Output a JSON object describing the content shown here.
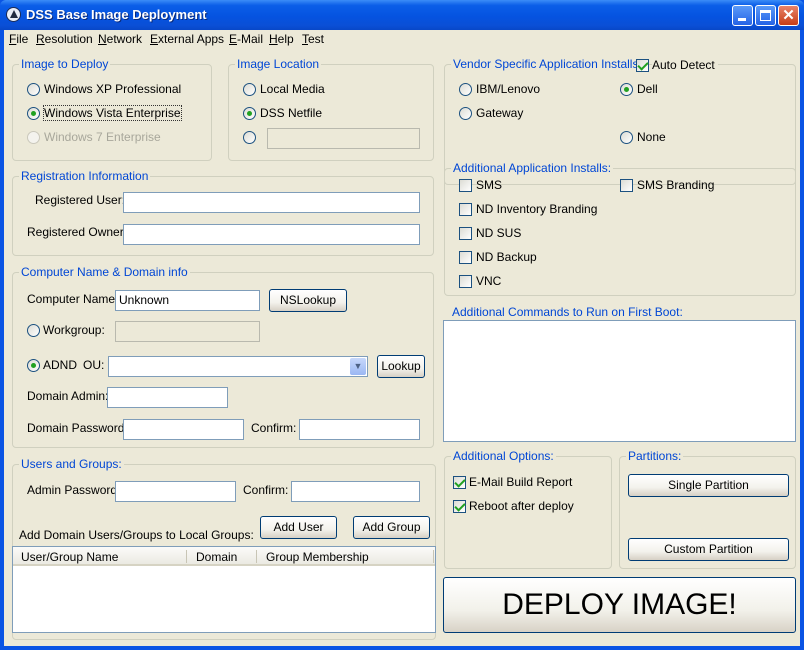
{
  "window": {
    "title": "DSS Base Image Deployment"
  },
  "menu": [
    "File",
    "Resolution",
    "Network",
    "External Apps",
    "E-Mail",
    "Help",
    "Test"
  ],
  "image_to_deploy": {
    "title": "Image to Deploy",
    "options": [
      {
        "label": "Windows XP Professional",
        "selected": false,
        "enabled": true
      },
      {
        "label": "Windows Vista Enterprise",
        "selected": true,
        "enabled": true
      },
      {
        "label": "Windows 7 Enterprise",
        "selected": false,
        "enabled": false
      }
    ]
  },
  "image_location": {
    "title": "Image Location",
    "options": [
      {
        "label": "Local Media",
        "selected": false
      },
      {
        "label": "DSS Netfile",
        "selected": true
      },
      {
        "label": "",
        "selected": false
      }
    ],
    "custom_path": ""
  },
  "registration": {
    "title": "Registration Information",
    "user_label": "Registered User:",
    "user_value": "",
    "owner_label": "Registered Owner:",
    "owner_value": ""
  },
  "computer": {
    "title": "Computer Name & Domain info",
    "name_label": "Computer Name:",
    "name_value": "Unknown",
    "nslookup_label": "NSLookup",
    "workgroup_label": "Workgroup:",
    "workgroup_value": "",
    "adnd_label": "ADND",
    "ou_label": "OU:",
    "ou_value": "",
    "lookup_label": "Lookup",
    "domain_admin_label": "Domain Admin:",
    "domain_admin_value": "",
    "domain_password_label": "Domain Password:",
    "domain_password_value": "",
    "confirm_label": "Confirm:",
    "confirm_value": ""
  },
  "users_groups": {
    "title": "Users and Groups:",
    "admin_password_label": "Admin Password:",
    "admin_password_value": "",
    "confirm_label": "Confirm:",
    "confirm_value": "",
    "add_user_label": "Add User",
    "add_group_label": "Add Group",
    "caption": "Add Domain Users/Groups to Local Groups:",
    "columns": [
      "User/Group Name",
      "Domain",
      "Group Membership"
    ],
    "rows": []
  },
  "vendor": {
    "title": "Vendor Specific Application Installs:",
    "auto_detect_label": "Auto Detect",
    "auto_detect_checked": true,
    "options": [
      {
        "label": "IBM/Lenovo",
        "selected": false
      },
      {
        "label": "Dell",
        "selected": true
      },
      {
        "label": "Gateway",
        "selected": false
      },
      {
        "label": "None",
        "selected": false
      }
    ]
  },
  "additional_apps": {
    "title": "Additional Application Installs:",
    "items": [
      {
        "label": "SMS",
        "checked": false
      },
      {
        "label": "SMS Branding",
        "checked": false
      },
      {
        "label": "ND Inventory Branding",
        "checked": false
      },
      {
        "label": "ND SUS",
        "checked": false
      },
      {
        "label": "ND Backup",
        "checked": false
      },
      {
        "label": "VNC",
        "checked": false
      }
    ]
  },
  "first_boot": {
    "title": "Additional Commands to Run on First Boot:",
    "value": ""
  },
  "options": {
    "title": "Additional Options:",
    "items": [
      {
        "label": "E-Mail Build Report",
        "checked": true
      },
      {
        "label": "Reboot after deploy",
        "checked": true
      }
    ]
  },
  "partitions": {
    "title": "Partitions:",
    "single_label": "Single Partition",
    "custom_label": "Custom Partition"
  },
  "deploy": {
    "label": "DEPLOY IMAGE!"
  }
}
